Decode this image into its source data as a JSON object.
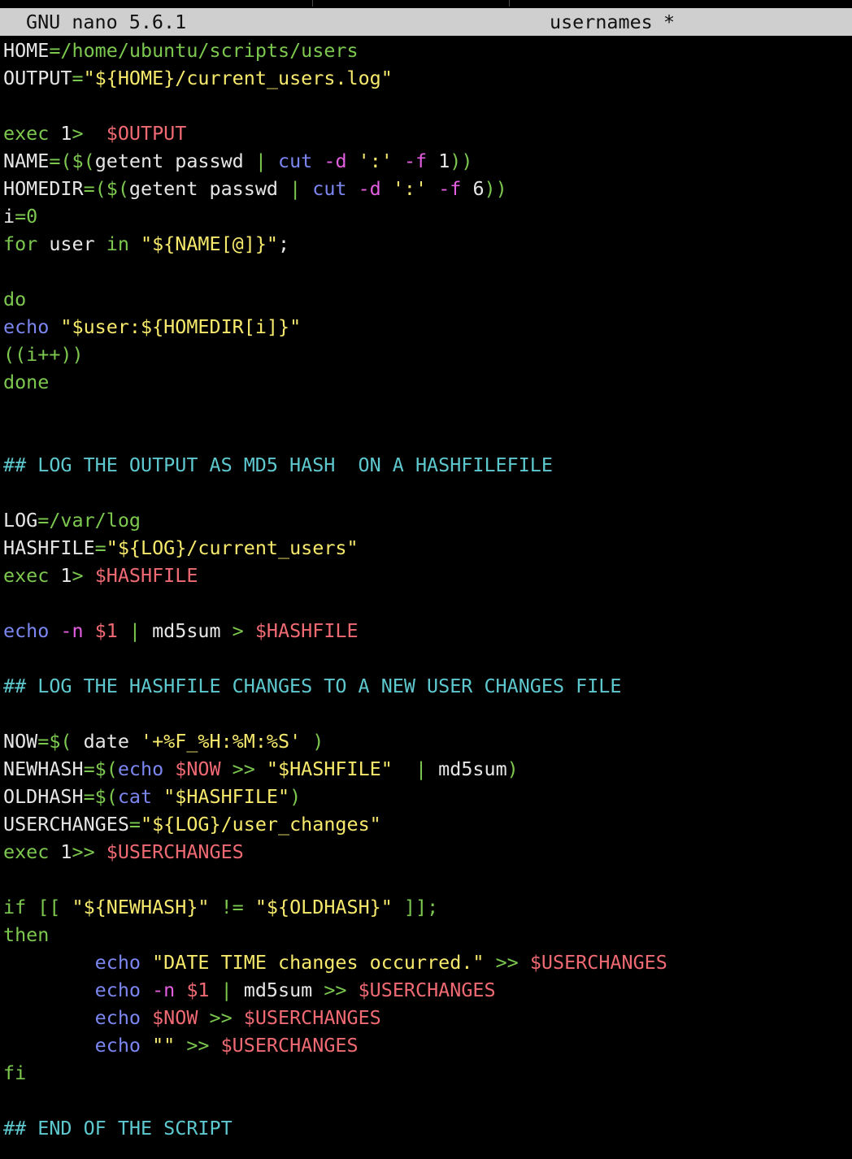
{
  "titlebar": {
    "app": "GNU nano 5.6.1",
    "filename": "usernames",
    "modified": "*"
  },
  "colors": {
    "background": "#000000",
    "titlebar_bg": "#cfcfcf",
    "default": "#e6e6e6",
    "keyword": "#7cc84f",
    "string": "#f6e96b",
    "variable": "#ef6a72",
    "builtin": "#7b86f0",
    "option": "#e35ee0",
    "comment": "#5ec8cf"
  },
  "lines": [
    [
      [
        "w",
        "HOME"
      ],
      [
        "g",
        "=/home/ubuntu/scripts/users"
      ]
    ],
    [
      [
        "w",
        "OUTPUT"
      ],
      [
        "g",
        "="
      ],
      [
        "y",
        "\"${HOME}/current_users.log\""
      ]
    ],
    [],
    [
      [
        "g",
        "exec "
      ],
      [
        "w",
        "1"
      ],
      [
        "g",
        ">  "
      ],
      [
        "r",
        "$OUTPUT"
      ]
    ],
    [
      [
        "w",
        "NAME"
      ],
      [
        "g",
        "=($("
      ],
      [
        "w",
        "getent passwd "
      ],
      [
        "g",
        "| "
      ],
      [
        "b",
        "cut "
      ],
      [
        "m",
        "-d "
      ],
      [
        "y",
        "':' "
      ],
      [
        "m",
        "-f "
      ],
      [
        "w",
        "1"
      ],
      [
        "g",
        "))"
      ]
    ],
    [
      [
        "w",
        "HOMEDIR"
      ],
      [
        "g",
        "=($("
      ],
      [
        "w",
        "getent passwd "
      ],
      [
        "g",
        "| "
      ],
      [
        "b",
        "cut "
      ],
      [
        "m",
        "-d "
      ],
      [
        "y",
        "':' "
      ],
      [
        "m",
        "-f "
      ],
      [
        "w",
        "6"
      ],
      [
        "g",
        "))"
      ]
    ],
    [
      [
        "w",
        "i"
      ],
      [
        "g",
        "=0"
      ]
    ],
    [
      [
        "g",
        "for "
      ],
      [
        "w",
        "user "
      ],
      [
        "g",
        "in "
      ],
      [
        "y",
        "\"${NAME[@]}\""
      ],
      [
        "w",
        ";"
      ]
    ],
    [],
    [
      [
        "g",
        "do"
      ]
    ],
    [
      [
        "b",
        "echo "
      ],
      [
        "y",
        "\"$user:${HOMEDIR[i]}\""
      ]
    ],
    [
      [
        "g",
        "((i++))"
      ]
    ],
    [
      [
        "g",
        "done"
      ]
    ],
    [],
    [],
    [
      [
        "c",
        "## LOG THE OUTPUT AS MD5 HASH  ON A HASHFILEFILE"
      ]
    ],
    [],
    [
      [
        "w",
        "LOG"
      ],
      [
        "g",
        "=/var/log"
      ]
    ],
    [
      [
        "w",
        "HASHFILE"
      ],
      [
        "g",
        "="
      ],
      [
        "y",
        "\"${LOG}/current_users\""
      ]
    ],
    [
      [
        "g",
        "exec "
      ],
      [
        "w",
        "1"
      ],
      [
        "g",
        "> "
      ],
      [
        "r",
        "$HASHFILE"
      ]
    ],
    [],
    [
      [
        "b",
        "echo "
      ],
      [
        "m",
        "-n "
      ],
      [
        "r",
        "$1 "
      ],
      [
        "g",
        "| "
      ],
      [
        "w",
        "md5sum "
      ],
      [
        "g",
        "> "
      ],
      [
        "r",
        "$HASHFILE"
      ]
    ],
    [],
    [
      [
        "c",
        "## LOG THE HASHFILE CHANGES TO A NEW USER CHANGES FILE"
      ]
    ],
    [],
    [
      [
        "w",
        "NOW"
      ],
      [
        "g",
        "=$( "
      ],
      [
        "w",
        "date "
      ],
      [
        "y",
        "'+%F_%H:%M:%S' "
      ],
      [
        "g",
        ")"
      ]
    ],
    [
      [
        "w",
        "NEWHASH"
      ],
      [
        "g",
        "=$("
      ],
      [
        "b",
        "echo "
      ],
      [
        "r",
        "$NOW "
      ],
      [
        "g",
        ">> "
      ],
      [
        "y",
        "\"$HASHFILE\"  "
      ],
      [
        "g",
        "| "
      ],
      [
        "w",
        "md5sum"
      ],
      [
        "g",
        ")"
      ]
    ],
    [
      [
        "w",
        "OLDHASH"
      ],
      [
        "g",
        "=$("
      ],
      [
        "b",
        "cat "
      ],
      [
        "y",
        "\"$HASHFILE\""
      ],
      [
        "g",
        ")"
      ]
    ],
    [
      [
        "w",
        "USERCHANGES"
      ],
      [
        "g",
        "="
      ],
      [
        "y",
        "\"${LOG}/user_changes\""
      ]
    ],
    [
      [
        "g",
        "exec "
      ],
      [
        "w",
        "1"
      ],
      [
        "g",
        ">> "
      ],
      [
        "r",
        "$USERCHANGES"
      ]
    ],
    [],
    [
      [
        "g",
        "if [[ "
      ],
      [
        "y",
        "\"${NEWHASH}\" "
      ],
      [
        "g",
        "!= "
      ],
      [
        "y",
        "\"${OLDHASH}\" "
      ],
      [
        "g",
        "]];"
      ]
    ],
    [
      [
        "g",
        "then"
      ]
    ],
    [
      [
        "w",
        "        "
      ],
      [
        "b",
        "echo "
      ],
      [
        "y",
        "\"DATE TIME changes occurred.\" "
      ],
      [
        "g",
        ">> "
      ],
      [
        "r",
        "$USERCHANGES"
      ]
    ],
    [
      [
        "w",
        "        "
      ],
      [
        "b",
        "echo "
      ],
      [
        "m",
        "-n "
      ],
      [
        "r",
        "$1 "
      ],
      [
        "g",
        "| "
      ],
      [
        "w",
        "md5sum "
      ],
      [
        "g",
        ">> "
      ],
      [
        "r",
        "$USERCHANGES"
      ]
    ],
    [
      [
        "w",
        "        "
      ],
      [
        "b",
        "echo "
      ],
      [
        "r",
        "$NOW "
      ],
      [
        "g",
        ">> "
      ],
      [
        "r",
        "$USERCHANGES"
      ]
    ],
    [
      [
        "w",
        "        "
      ],
      [
        "b",
        "echo "
      ],
      [
        "y",
        "\"\" "
      ],
      [
        "g",
        ">> "
      ],
      [
        "r",
        "$USERCHANGES"
      ]
    ],
    [
      [
        "g",
        "fi"
      ]
    ],
    [],
    [
      [
        "c",
        "## END OF THE SCRIPT"
      ]
    ]
  ]
}
